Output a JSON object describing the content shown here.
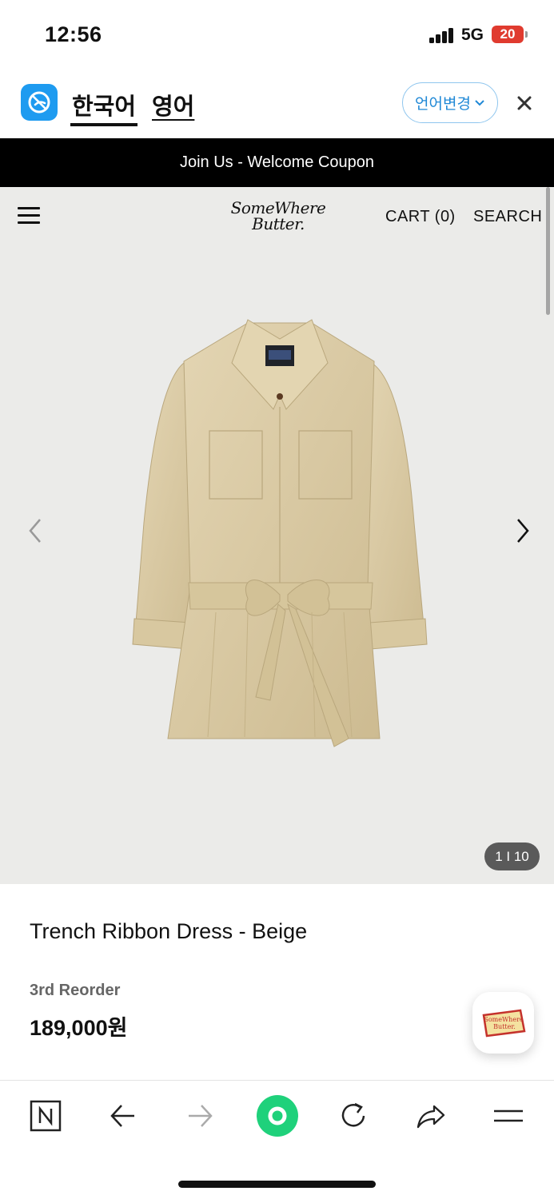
{
  "status_bar": {
    "time": "12:56",
    "network": "5G",
    "battery": "20"
  },
  "translate_bar": {
    "languages": [
      "한국어",
      "영어"
    ],
    "active_language": "한국어",
    "change_label": "언어변경",
    "accent_color": "#1f88d6"
  },
  "promo": {
    "text": "Join Us - Welcome Coupon"
  },
  "header": {
    "brand_line1": "SomeWhere",
    "brand_line2": "Butter.",
    "cart_label": "CART (0)",
    "search_label": "SEARCH"
  },
  "gallery": {
    "counter": "1 I 10",
    "current": 1,
    "total": 10
  },
  "product": {
    "title": "Trench Ribbon Dress - Beige",
    "badge": "3rd Reorder",
    "price": "189,000원",
    "color_swatch": "#d9c9a3"
  },
  "fab": {
    "brand_line1": "SomeWhere",
    "brand_line2": "Butter."
  },
  "toolbar": {
    "icons": [
      "naver-icon",
      "back-icon",
      "forward-icon",
      "home-icon",
      "reload-icon",
      "share-icon",
      "menu-icon"
    ]
  }
}
